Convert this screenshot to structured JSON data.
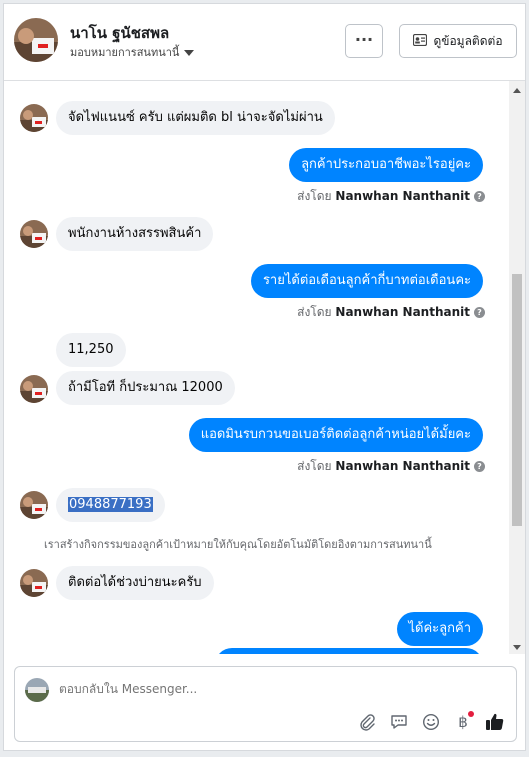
{
  "header": {
    "name": "นาโน ฐนัชสพล",
    "subtitle": "มอบหมายการสนทนานี้",
    "more_label": "···",
    "contact_label": "ดูข้อมูลติดต่อ"
  },
  "messages": {
    "m1": "จัดไฟแนนซ์ ครับ แต่ผมติด bl น่าจะจัดไม่ผ่าน",
    "m2": "ลูกค้าประกอบอาชีพอะไรอยู่คะ",
    "m3": "พนักงานห้างสรรพสินค้า",
    "m4": "รายได้ต่อเดือนลูกค้ากี่บาทต่อเดือนคะ",
    "m5": "11,250",
    "m6": "ถ้ามีโอที ก็ประมาณ 12000",
    "m7": "แอดมินรบกวนขอเบอร์ติดต่อลูกค้าหน่อยได้มั้ยคะ",
    "m8": "0948877193",
    "m9": "ติดต่อได้ช่วงบ่ายนะครับ",
    "m10": "ได้ค่ะลูกค้า"
  },
  "sent_by": {
    "prefix": "ส่งโดย",
    "name": "Nanwhan Nanthanit"
  },
  "system_message": "เราสร้างกิจกรรมของลูกค้าเป้าหมายให้กับคุณโดยอัตโนมัติโดยอิงตามการสนทนานี้",
  "composer": {
    "placeholder": "ตอบกลับใน Messenger..."
  },
  "colors": {
    "outgoing_bubble": "#0084ff",
    "incoming_bubble": "#f0f2f5",
    "like_icon": "#1c1e21"
  },
  "icons": [
    "ellipsis-icon",
    "contact-card-icon",
    "attachment-icon",
    "saved-reply-icon",
    "emoji-icon",
    "baht-payment-icon",
    "thumbs-up-icon"
  ]
}
